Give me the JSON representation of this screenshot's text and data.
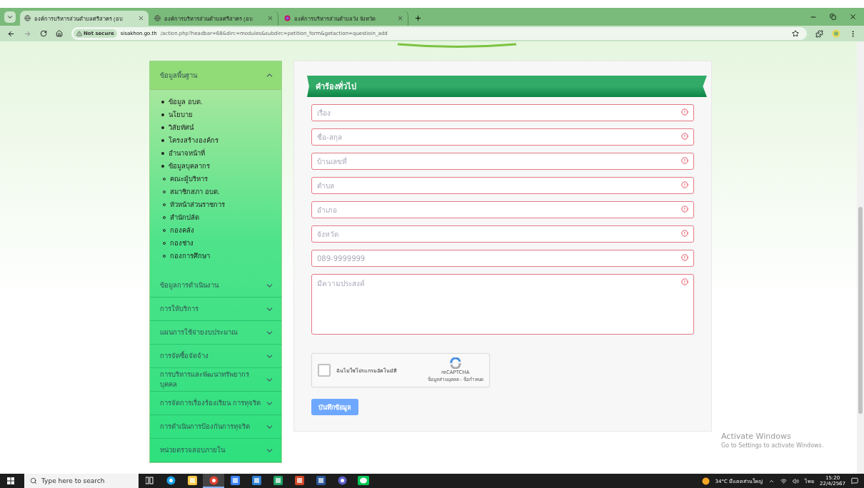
{
  "browser": {
    "tabs": [
      {
        "title": "องค์การบริหารส่วนตำบลศรีสาคร (อบ",
        "selected": true,
        "kind": "globe"
      },
      {
        "title": "องค์การบริหารส่วนตำบลศรีสาคร (อบ",
        "selected": false,
        "kind": "globe"
      },
      {
        "title": "องค์การบริหารส่วนตำบลวัง จังหวัด",
        "selected": false,
        "kind": "site"
      }
    ],
    "security": "Not secure",
    "host": "sisakhon.go.th",
    "path": "/action.php?headbar=68&dirc=modules&subdirc=petition_form&getaction=questioin_add"
  },
  "sidebar": [
    {
      "title": "ข้อมูลพื้นฐาน",
      "expanded": true,
      "items": [
        {
          "label": "ข้อมูล อบต."
        },
        {
          "label": "นโยบาย"
        },
        {
          "label": "วิสัยทัศน์"
        },
        {
          "label": "โครงสร้างองค์กร"
        },
        {
          "label": "อำนาจหน้าที่"
        },
        {
          "label": "ข้อมูลบุคลากร",
          "children": [
            {
              "label": "คณะผู้บริหาร"
            },
            {
              "label": "สมาชิกสภา อบต."
            },
            {
              "label": "หัวหน้าส่วนราชการ"
            },
            {
              "label": "สำนักปลัด"
            },
            {
              "label": "กองคลัง"
            },
            {
              "label": "กองช่าง"
            },
            {
              "label": "กองการศึกษา"
            }
          ]
        }
      ]
    },
    {
      "title": "ข้อมูลการดำเนินงาน",
      "expanded": false
    },
    {
      "title": "การให้บริการ",
      "expanded": false
    },
    {
      "title": "แผนการใช้จ่ายงบประมาณ",
      "expanded": false
    },
    {
      "title": "การจัดซื้อจัดจ้าง",
      "expanded": false
    },
    {
      "title": "การบริหารและพัฒนาทรัพยากรบุคคล",
      "expanded": false
    },
    {
      "title": "การจัดการเรื่องร้องเรียน การทุจริต",
      "expanded": false
    },
    {
      "title": "การดำเนินการป้องกันการทุจริต",
      "expanded": false
    },
    {
      "title": "หน่วยตรวจสอบภายใน",
      "expanded": false
    }
  ],
  "form": {
    "title": "คำร้องทั่วไป",
    "fields": [
      {
        "placeholder": "เรื่อง",
        "kind": "input"
      },
      {
        "placeholder": "ชื่อ-สกุล",
        "kind": "input"
      },
      {
        "placeholder": "บ้านเลขที่",
        "kind": "input"
      },
      {
        "placeholder": "ตำบล",
        "kind": "input"
      },
      {
        "placeholder": "อำเภอ",
        "kind": "input"
      },
      {
        "placeholder": "จังหวัด",
        "kind": "input"
      },
      {
        "placeholder": "089-9999999",
        "kind": "input"
      },
      {
        "placeholder": "มีความประสงค์",
        "kind": "textarea"
      }
    ],
    "captcha": {
      "label": "ฉันไม่ใช่โปรแกรมอัตโนมัติ",
      "brand": "reCAPTCHA",
      "links": "ข้อมูลส่วนบุคคล - ข้อกำหนด",
      "checked": false
    },
    "submit": "บันทึกข้อมูล"
  },
  "activation": {
    "title": "Activate Windows",
    "subtitle": "Go to Settings to activate Windows."
  },
  "taskbar": {
    "search": "Type here to search",
    "apps": [
      {
        "kind": "taskview",
        "selected": false
      },
      {
        "kind": "edge",
        "selected": false
      },
      {
        "kind": "files",
        "selected": false
      },
      {
        "kind": "chrome",
        "selected": true
      },
      {
        "kind": "store",
        "selected": false
      },
      {
        "kind": "mail",
        "selected": false
      },
      {
        "kind": "excel",
        "selected": false
      },
      {
        "kind": "powerpoint",
        "selected": false
      },
      {
        "kind": "word",
        "selected": false
      },
      {
        "kind": "teams",
        "selected": false
      },
      {
        "kind": "chat",
        "selected": false
      }
    ],
    "weather": "34°C มีแดดส่วนใหญ่",
    "language": "ไทย",
    "time": "15:20",
    "date": "22/4/2567"
  }
}
